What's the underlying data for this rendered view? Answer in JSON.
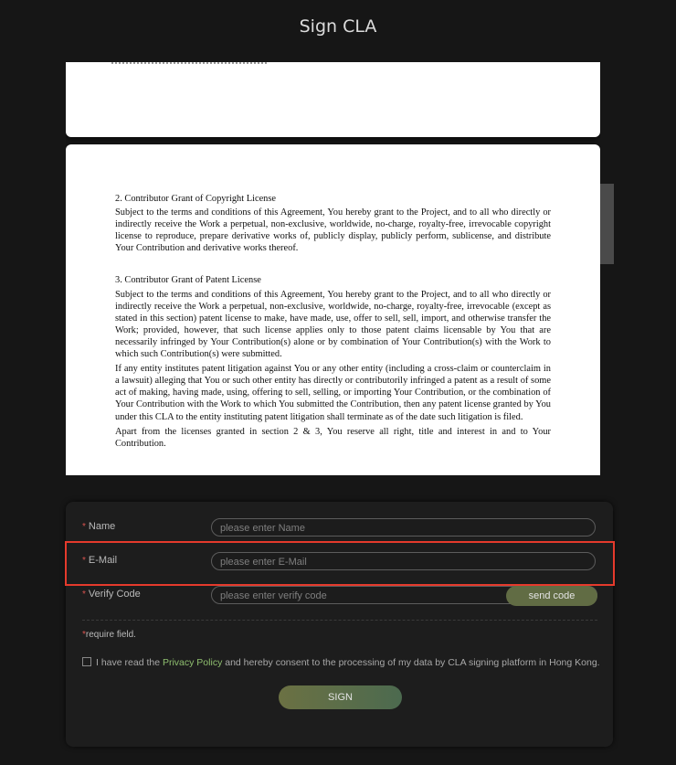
{
  "title": "Sign CLA",
  "document": {
    "section2_heading": "2. Contributor Grant of Copyright License",
    "section2_body": "Subject to the terms and conditions of this Agreement, You hereby grant to the Project, and to all who directly or indirectly receive the Work a perpetual, non-exclusive, worldwide, no-charge, royalty-free, irrevocable copyright license to reproduce, prepare derivative works of, publicly display, publicly perform, sublicense, and distribute Your Contribution and derivative works thereof.",
    "section3_heading": "3. Contributor Grant of Patent License",
    "section3_body1": "Subject to the terms and conditions of this Agreement, You hereby grant to the Project, and to all who directly or indirectly receive the Work a perpetual, non-exclusive, worldwide, no-charge, royalty-free, irrevocable (except as stated in this section) patent license to make, have made, use, offer to sell, sell, import, and otherwise transfer the Work; provided, however, that such license applies only to those patent claims licensable by You that are necessarily infringed by Your Contribution(s) alone or by combination of Your Contribution(s) with the Work to which such Contribution(s) were submitted.",
    "section3_body2": "If any entity institutes patent litigation against You or any other entity (including a cross-claim or counterclaim in a lawsuit) alleging that You or such other entity has directly or contributorily infringed a patent as a result of some act of making, having made, using, offering to sell, selling, or importing Your Contribution, or the combination of Your Contribution with the Work to which You submitted the Contribution, then any patent license granted by You under this CLA to the entity instituting patent litigation shall terminate as of the date such litigation is filed.",
    "section3_body3": "Apart from the licenses granted in section 2 & 3, You reserve all right, title and interest in and to Your Contribution."
  },
  "form": {
    "required_marker": "*",
    "name_label": "Name",
    "name_placeholder": "please enter Name",
    "email_label": "E-Mail",
    "email_placeholder": "please enter E-Mail",
    "verify_label": "Verify Code",
    "verify_placeholder": "please enter verify code",
    "send_code_label": "send code",
    "required_note": "require field.",
    "consent_prefix": "I have read the ",
    "consent_link": "Privacy Policy",
    "consent_suffix": " and hereby consent to the processing of my data by CLA signing platform in Hong Kong.",
    "sign_label": "SIGN"
  },
  "colors": {
    "background": "#161616",
    "accent": "#616c44",
    "link": "#8fbf6f",
    "highlight": "#e53a2c"
  }
}
